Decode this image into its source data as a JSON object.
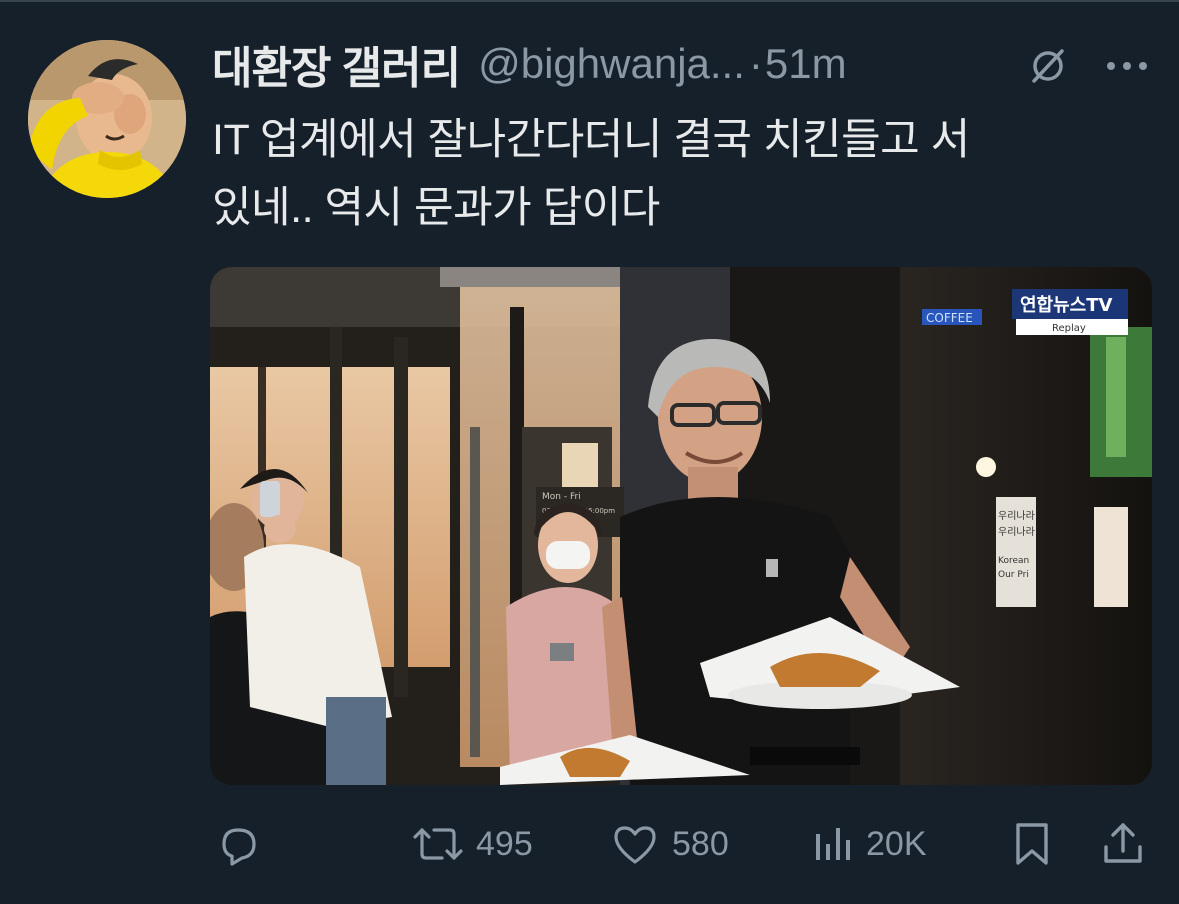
{
  "tweet": {
    "display_name": "대환장 갤러리",
    "handle": "@bighwanja...",
    "separator": "·",
    "time": "51m",
    "text_line1": "IT 업계에서 잘나간다더니 결국 치킨들고 서",
    "text_line2": "있네.. 역시 문과가 답이다",
    "media": {
      "broadcaster": "연합뉴스TV",
      "badge": "Replay",
      "sign_coffee": "COFFEE",
      "sign_hours": "Mon - Fri",
      "sign_hours_time": "07:00am ~ 06:00pm",
      "sign_banner_top": "우리나라",
      "sign_banner_mid": "우리나라",
      "sign_banner_en": "Korean",
      "sign_banner_en2": "Our Pri"
    }
  },
  "actions": {
    "reply_icon": "reply-icon",
    "retweet_icon": "retweet-icon",
    "retweet_count": "495",
    "like_icon": "heart-icon",
    "like_count": "580",
    "views_icon": "views-icon",
    "views_count": "20K",
    "bookmark_icon": "bookmark-icon",
    "share_icon": "share-icon"
  },
  "colors": {
    "background": "#15202b",
    "text_primary": "#e7e9ea",
    "text_secondary": "#8b98a5"
  }
}
